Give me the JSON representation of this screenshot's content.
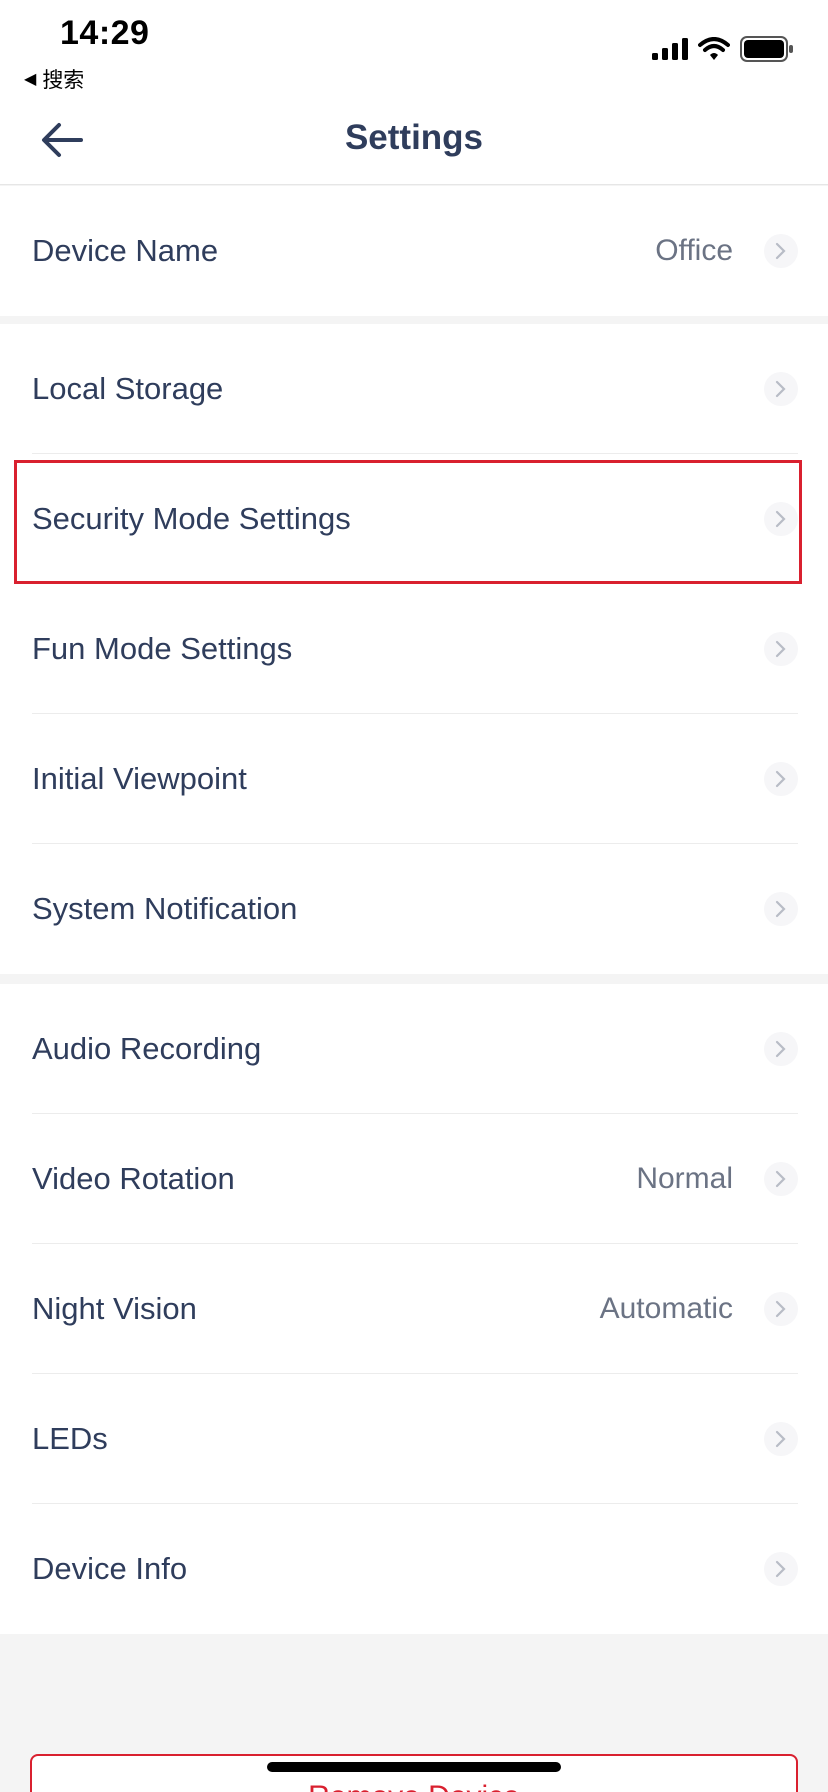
{
  "status_bar": {
    "time": "14:29",
    "back_app": "搜索",
    "icons": [
      "signal-icon",
      "wifi-icon",
      "battery-icon"
    ]
  },
  "nav": {
    "title": "Settings",
    "back_icon": "arrow-left-icon"
  },
  "groups": [
    {
      "items": [
        {
          "label": "Device Name",
          "value": "Office"
        }
      ]
    },
    {
      "items": [
        {
          "label": "Local Storage",
          "value": ""
        },
        {
          "label": "Security Mode Settings",
          "value": "",
          "highlighted": true
        },
        {
          "label": "Fun Mode Settings",
          "value": ""
        },
        {
          "label": "Initial Viewpoint",
          "value": ""
        },
        {
          "label": "System Notification",
          "value": ""
        }
      ]
    },
    {
      "items": [
        {
          "label": "Audio Recording",
          "value": ""
        },
        {
          "label": "Video Rotation",
          "value": "Normal"
        },
        {
          "label": "Night Vision",
          "value": "Automatic"
        },
        {
          "label": "LEDs",
          "value": ""
        },
        {
          "label": "Device Info",
          "value": ""
        }
      ]
    }
  ],
  "remove_button": {
    "label": "Remove Device"
  },
  "colors": {
    "text": "#2f3d5c",
    "value": "#6b7384",
    "accent_red": "#d9202f",
    "background": "#f4f4f4"
  }
}
